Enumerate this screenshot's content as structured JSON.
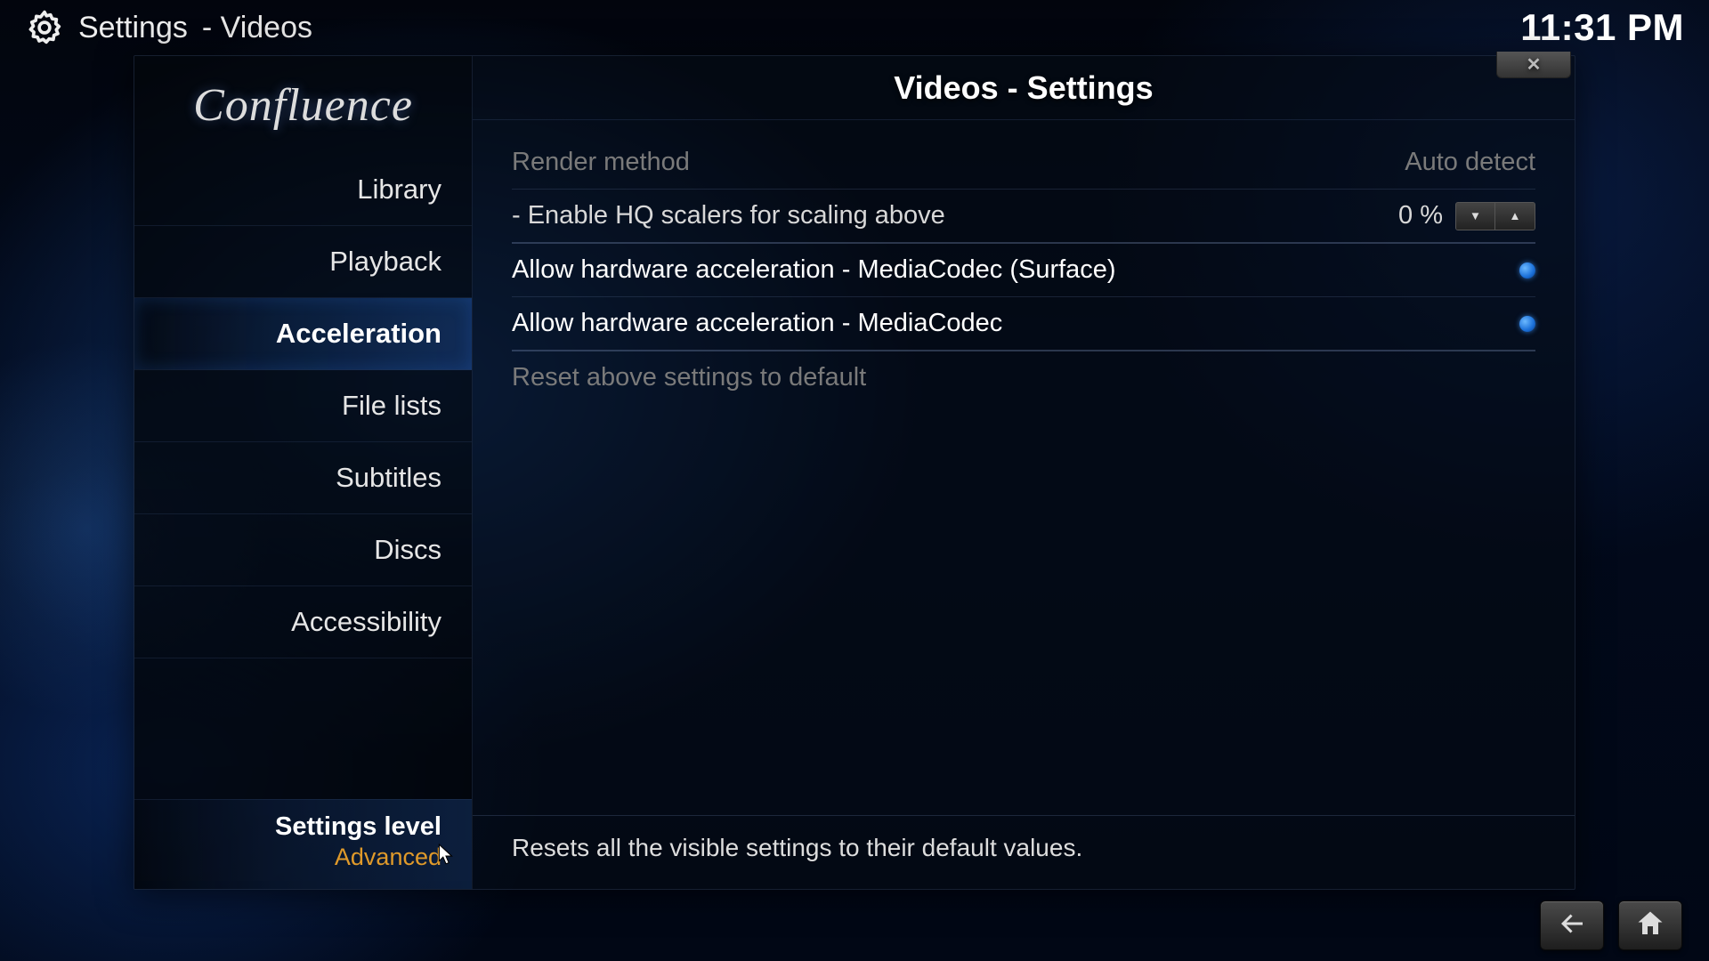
{
  "topbar": {
    "breadcrumb_main": "Settings",
    "breadcrumb_sub": "- Videos",
    "clock": "11:31 PM"
  },
  "logo": "Confluence",
  "sidebar": {
    "items": [
      {
        "label": "Library"
      },
      {
        "label": "Playback"
      },
      {
        "label": "Acceleration"
      },
      {
        "label": "File lists"
      },
      {
        "label": "Subtitles"
      },
      {
        "label": "Discs"
      },
      {
        "label": "Accessibility"
      }
    ],
    "active_index": 2,
    "level_title": "Settings level",
    "level_value": "Advanced"
  },
  "content": {
    "title": "Videos - Settings",
    "rows": {
      "render_method": {
        "label": "Render method",
        "value": "Auto detect"
      },
      "hq_scalers": {
        "label": "- Enable HQ scalers for scaling above",
        "value": "0 %"
      },
      "hw_surface": {
        "label": "Allow hardware acceleration - MediaCodec (Surface)",
        "enabled": true
      },
      "hw_mediacodec": {
        "label": "Allow hardware acceleration - MediaCodec",
        "enabled": true
      },
      "reset": {
        "label": "Reset above settings to default"
      }
    },
    "description": "Resets all the visible settings to their default values."
  }
}
